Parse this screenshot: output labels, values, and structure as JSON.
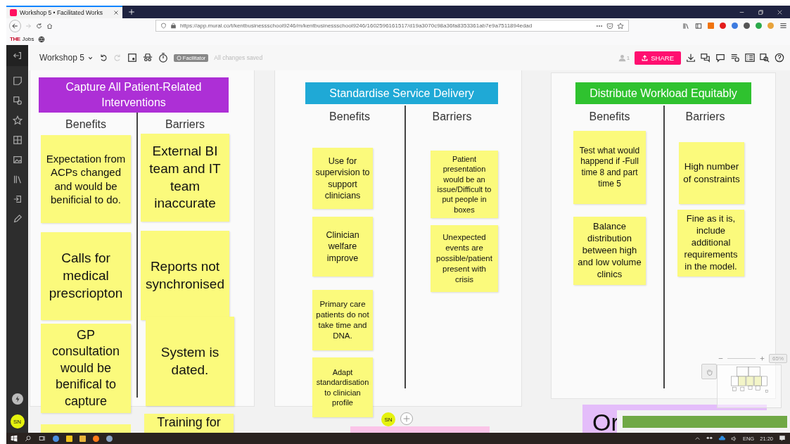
{
  "browser": {
    "tab_title": "Workshop 5 • Facilitated Works",
    "url": "https://app.mural.co/t/kentbusinessschool9246/m/kentbusinessschool9246/1602596161517/d19a3070c98a36fa8353361ab7e9a7511894edad",
    "bookmark": {
      "logo": "THE",
      "label": "Jobs"
    }
  },
  "toolbar": {
    "board_title": "Workshop 5",
    "role_badge": "Facilitator",
    "save_status": "All changes saved",
    "collaborator_count": "1",
    "share_label": "SHARE"
  },
  "sidebar": {
    "avatar": "SN"
  },
  "panels": [
    {
      "title": "Capture All Patient-Related Interventions",
      "color": "#ad2fd6",
      "columns": [
        {
          "label": "Benefits",
          "notes": [
            {
              "text": "Expectation from ACPs changed and would be benificial to do."
            },
            {
              "text": "Calls for medical prescriopton"
            },
            {
              "text": "GP consultation would be benifical to capture"
            }
          ]
        },
        {
          "label": "Barriers",
          "notes": [
            {
              "text": "External BI team and IT team inaccurate"
            },
            {
              "text": "Reports not synchronised"
            },
            {
              "text": "System is dated."
            },
            {
              "text": "Training for"
            }
          ]
        }
      ]
    },
    {
      "title": "Standardise Service Delivery",
      "color": "#1fa9d6",
      "columns": [
        {
          "label": "Benefits",
          "notes": [
            {
              "text": "Use for supervision to support clinicians"
            },
            {
              "text": "Clinician welfare improve"
            },
            {
              "text": "Primary care patients do not take time and DNA."
            },
            {
              "text": "Adapt standardisation to clinician profile"
            }
          ]
        },
        {
          "label": "Barriers",
          "notes": [
            {
              "text": "Patient presentation would be an issue/Difficult to put people in boxes"
            },
            {
              "text": "Unexpected events are possible/patient present with crisis"
            }
          ]
        }
      ]
    },
    {
      "title": "Distribute Workload Equitably",
      "color": "#2fc22f",
      "columns": [
        {
          "label": "Benefits",
          "notes": [
            {
              "text": "Test what would happend if -Full time 8 and part time 5"
            },
            {
              "text": "Balance distribution between high and low volume clinics"
            }
          ]
        },
        {
          "label": "Barriers",
          "notes": [
            {
              "text": "High number of constraints"
            },
            {
              "text": "Fine as it is, include additional requirements in the model."
            }
          ]
        }
      ]
    }
  ],
  "stray_notes": [
    {
      "color": "#fbfa7c"
    },
    {
      "color": "#fbc4e8"
    },
    {
      "color": "#e4bdfa",
      "text": "Or"
    }
  ],
  "canvas": {
    "avatar": "SN",
    "zoom_level": "65%"
  },
  "taskbar": {
    "language": "ENG",
    "time": "21:20"
  }
}
